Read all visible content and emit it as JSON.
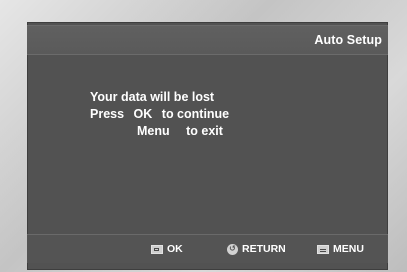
{
  "window": {
    "title": "Auto Setup"
  },
  "message": {
    "line1": "Your data will be lost",
    "line2_prefix": "Press",
    "line2_key": "OK",
    "line2_suffix": "to continue",
    "line3_key": "Menu",
    "line3_suffix": "to exit"
  },
  "footer": {
    "ok_label": "OK",
    "ok_icon": "enter-icon",
    "return_label": "RETURN",
    "return_icon": "return-icon",
    "menu_label": "MENU",
    "menu_icon": "menu-icon"
  },
  "colors": {
    "screen_bg": "#525252",
    "text": "#ffffff",
    "bezel": "#cfcfcf"
  }
}
